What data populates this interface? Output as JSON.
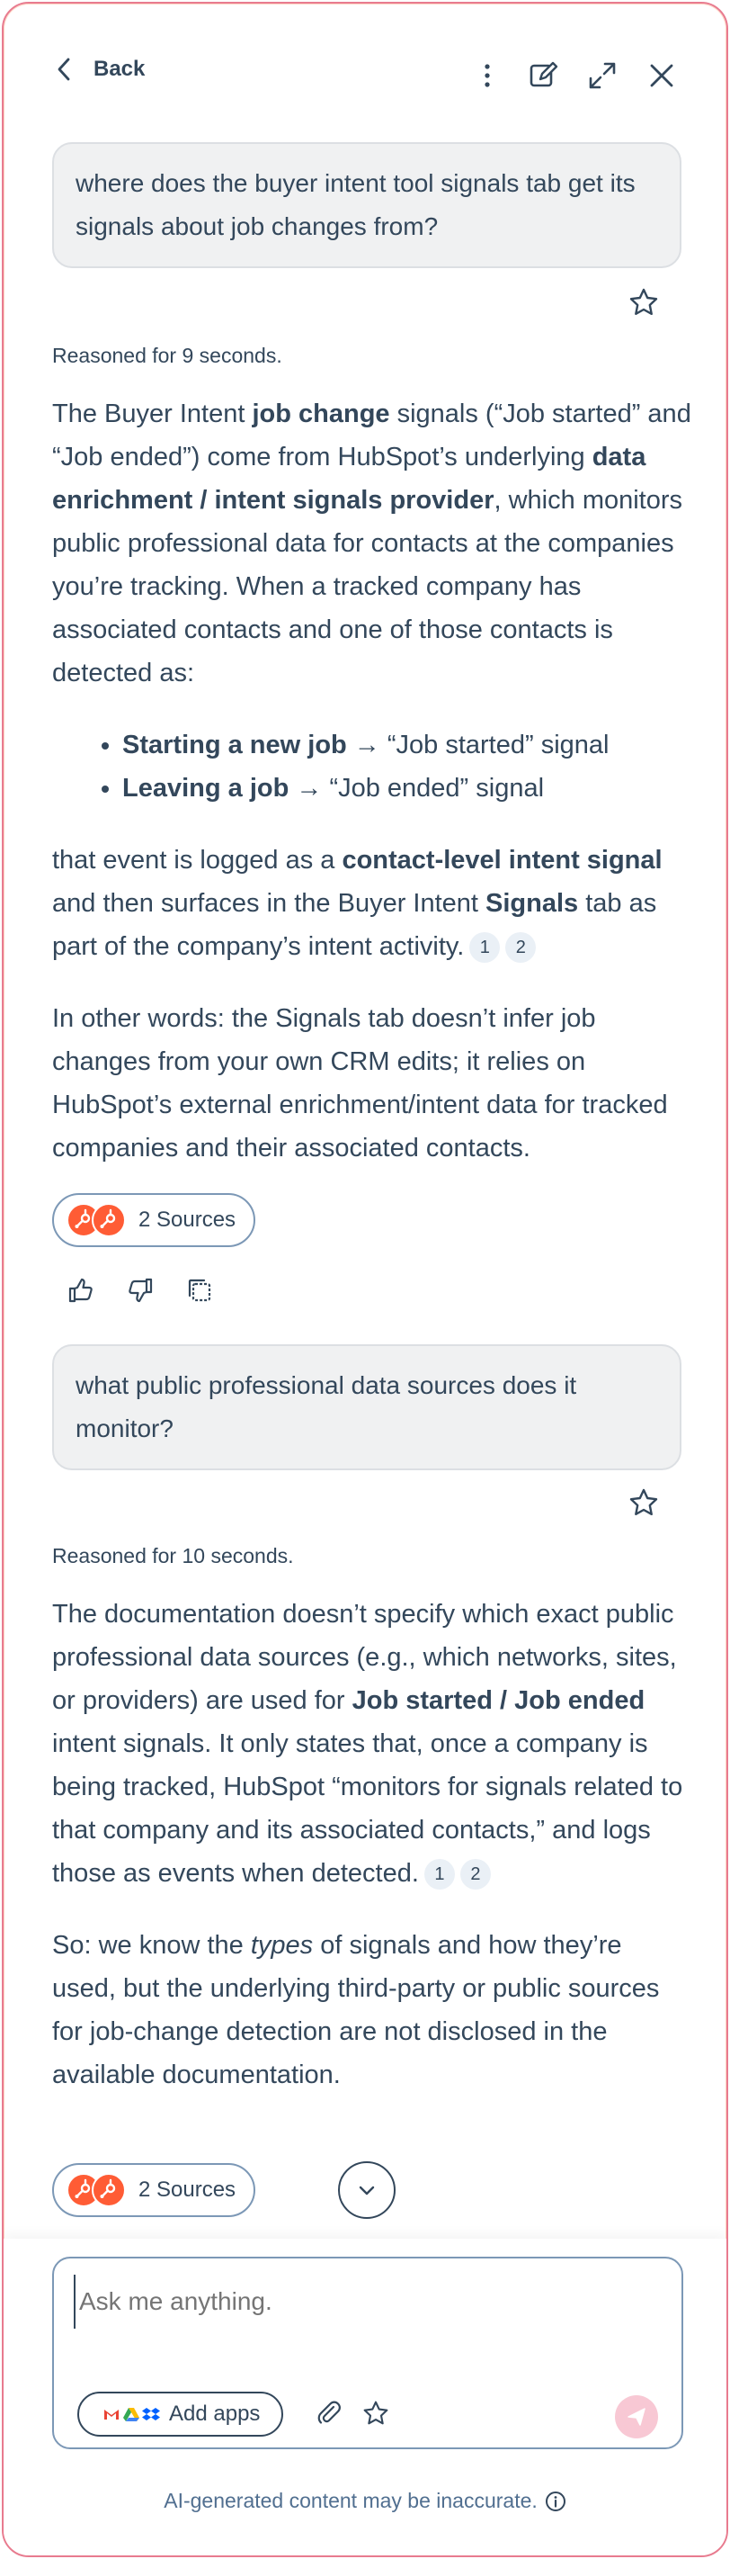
{
  "header": {
    "back_label": "Back",
    "icons": [
      "chevron-left-icon",
      "more-vertical-icon",
      "edit-icon",
      "expand-icon",
      "close-icon"
    ]
  },
  "conversation": [
    {
      "question": "where does the buyer intent tool signals tab get its signals about job changes from?",
      "reasoned": "Reasoned for 9 seconds.",
      "answer": {
        "p1": {
          "t1": "The Buyer Intent ",
          "b1": "job change",
          "t2": " signals (“Job started” and “Job ended”) come from HubSpot’s underlying ",
          "b2": "data enrichment / intent signals provider",
          "t3": ", which monitors public professional data for contacts at the companies you’re tracking. When a tracked company has associated contacts and one of those contacts is detected as:"
        },
        "bullets": [
          {
            "bold": "Starting a new job",
            "text": " → “Job started” signal"
          },
          {
            "bold": "Leaving a job",
            "text": " → “Job ended” signal"
          }
        ],
        "p2": {
          "t1": "that event is logged as a ",
          "b1": "contact-level intent signal",
          "t2": " and then surfaces in the Buyer Intent ",
          "b2": "Signals",
          "t3": " tab as part of the company’s intent activity."
        },
        "citations": [
          "1",
          "2"
        ],
        "p3": "In other words: the Signals tab doesn’t infer job changes from your own CRM edits; it relies on HubSpot’s external enrichment/intent data for tracked companies and their associated contacts."
      },
      "sources_label": "2 Sources"
    },
    {
      "question": "what public professional data sources does it monitor?",
      "reasoned": "Reasoned for 10 seconds.",
      "answer": {
        "p1": {
          "t1": "The documentation doesn’t specify which exact public professional data sources (e.g., which networks, sites, or providers) are used for ",
          "b1": "Job started / Job ended",
          "t2": " intent signals. It only states that, once a company is being tracked, HubSpot “monitors for signals related to that company and its associated contacts,” and logs those as events when detected."
        },
        "citations": [
          "1",
          "2"
        ],
        "p2": {
          "t1": "So: we know the ",
          "i1": "types",
          "t2": " of signals and how they’re used, but the underlying third-party or public sources for job-change detection are not disclosed in the available documentation."
        }
      },
      "sources_label": "2 Sources"
    }
  ],
  "composer": {
    "placeholder": "Ask me anything.",
    "add_apps_label": "Add apps",
    "disclaimer": "AI-generated content may be inaccurate."
  },
  "colors": {
    "text": "#33475b",
    "bubble_bg": "#f0f1f2",
    "hubspot_orange": "#ff5c35",
    "frame_border": "#e87b8f",
    "send_disabled": "#f8c8d4"
  }
}
